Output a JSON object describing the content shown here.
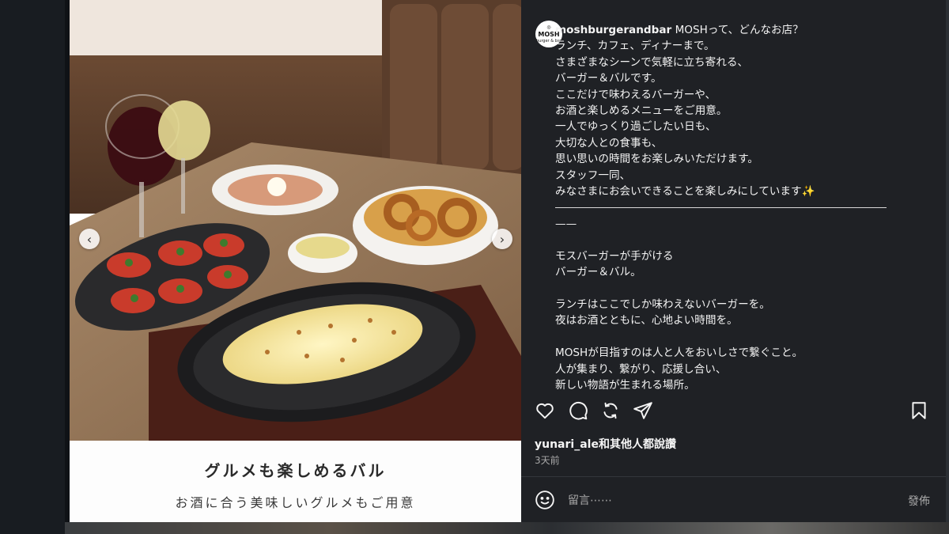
{
  "post": {
    "username": "moshburgerandbar",
    "avatar_text": "MOSH",
    "avatar_mark": "◎",
    "avatar_sub": "burger & bar",
    "caption_lines": [
      "MOSHって、どんなお店？",
      "ランチ、カフェ、ディナーまで。",
      "さまざまなシーンで気軽に立ち寄れる、",
      "バーガー＆バルです。",
      "ここだけで味わえるバーガーや、",
      "お酒と楽しめるメニューをご用意。",
      "一人でゆっくり過ごしたい日も、",
      "大切な人との食事も、",
      "思い思いの時間をお楽しみいただけます。",
      "スタッフ一同、",
      "みなさまにお会いできることを楽しみにしています✨"
    ],
    "caption_rule": "——",
    "caption_lines_2": [
      "モスバーガーが手がける",
      "バーガー＆バル。",
      "",
      "ランチはここでしか味わえないバーガーを。",
      "夜はお酒とともに、心地よい時間を。",
      "",
      "MOSHが目指すのは人と人をおいしさで繋ぐこと。",
      "人が集まり、繋がり、応援し合い、",
      "新しい物語が生まれる場所。"
    ]
  },
  "image_caption": {
    "title": "グルメも楽しめるバル",
    "subtitle": "お酒に合う美味しいグルメもご用意"
  },
  "carousel": {
    "prev_icon": "chevron-left-icon",
    "next_icon": "chevron-right-icon"
  },
  "engagement": {
    "likes_text": "yunari_ale和其他人都說讚",
    "time_ago": "3天前"
  },
  "comment": {
    "placeholder": "留言⋯⋯",
    "post_label": "發佈"
  },
  "icons": [
    "heart-icon",
    "comment-icon",
    "repost-icon",
    "share-icon",
    "bookmark-icon",
    "emoji-icon"
  ],
  "colors": {
    "panel_bg": "#1f2125",
    "text": "#f5f5f5",
    "muted": "#a8a8a8"
  }
}
